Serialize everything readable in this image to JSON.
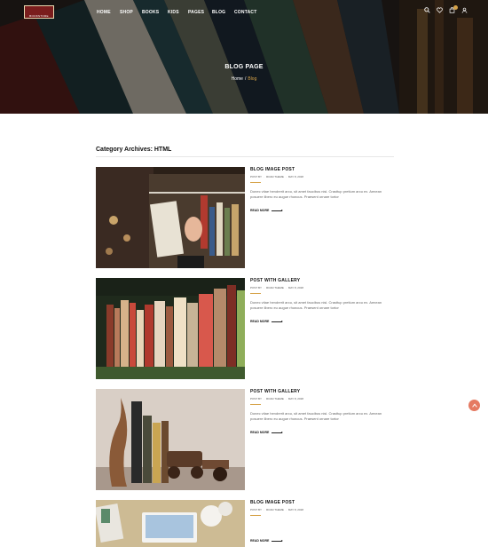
{
  "brand": {
    "logo_text": "BOOKSTORE"
  },
  "nav": {
    "items": [
      "HOME",
      "SHOP",
      "BOOKS",
      "KIDS",
      "PAGES",
      "BLOG",
      "CONTACT"
    ]
  },
  "header_icons": [
    "search-icon",
    "heart-icon",
    "cart-icon",
    "user-icon"
  ],
  "hero": {
    "title": "BLOG PAGE",
    "breadcrumb": {
      "home": "Home",
      "separator": "/",
      "current": "Blog"
    }
  },
  "section": {
    "title": "Category Archives: HTML"
  },
  "posts": [
    {
      "title": "BLOG IMAGE POST",
      "meta": [
        "POST BY",
        "·",
        "ROAD THEME",
        "·",
        "MAY 8, 2018"
      ],
      "excerpt": "Donec vitae hendrerit arcu, sit amet faucibus nisl. Crasttup pretium arcu ex. Aenean posuere libero eu augue rhoncus. Praesent ornare tortor",
      "read_more": "READ MORE"
    },
    {
      "title": "POST WITH GALLERY",
      "meta": [
        "POST BY",
        "·",
        "ROAD THEME",
        "·",
        "MAY 8, 2018"
      ],
      "excerpt": "Donec vitae hendrerit arcu, sit amet faucibus nisl. Crasttup pretium arcu ex. Aenean posuere libero eu augue rhoncus. Praesent ornare tortor",
      "read_more": "READ MORE"
    },
    {
      "title": "POST WITH GALLERY",
      "meta": [
        "POST BY",
        "·",
        "ROAD THEME",
        "·",
        "MAY 8, 2018"
      ],
      "excerpt": "Donec vitae hendrerit arcu, sit amet faucibus nisl. Crasttup pretium arcu ex. Aenean posuere libero eu augue rhoncus. Praesent ornare tortor",
      "read_more": "READ MORE"
    },
    {
      "title": "BLOG IMAGE POST",
      "meta": [
        "POST BY",
        "·",
        "ROAD THEME",
        "·",
        "MAY 8, 2018"
      ],
      "excerpt": "",
      "read_more": "READ MORE"
    }
  ],
  "colors": {
    "accent": "#d6a349",
    "scroll_top": "#e57a62"
  }
}
